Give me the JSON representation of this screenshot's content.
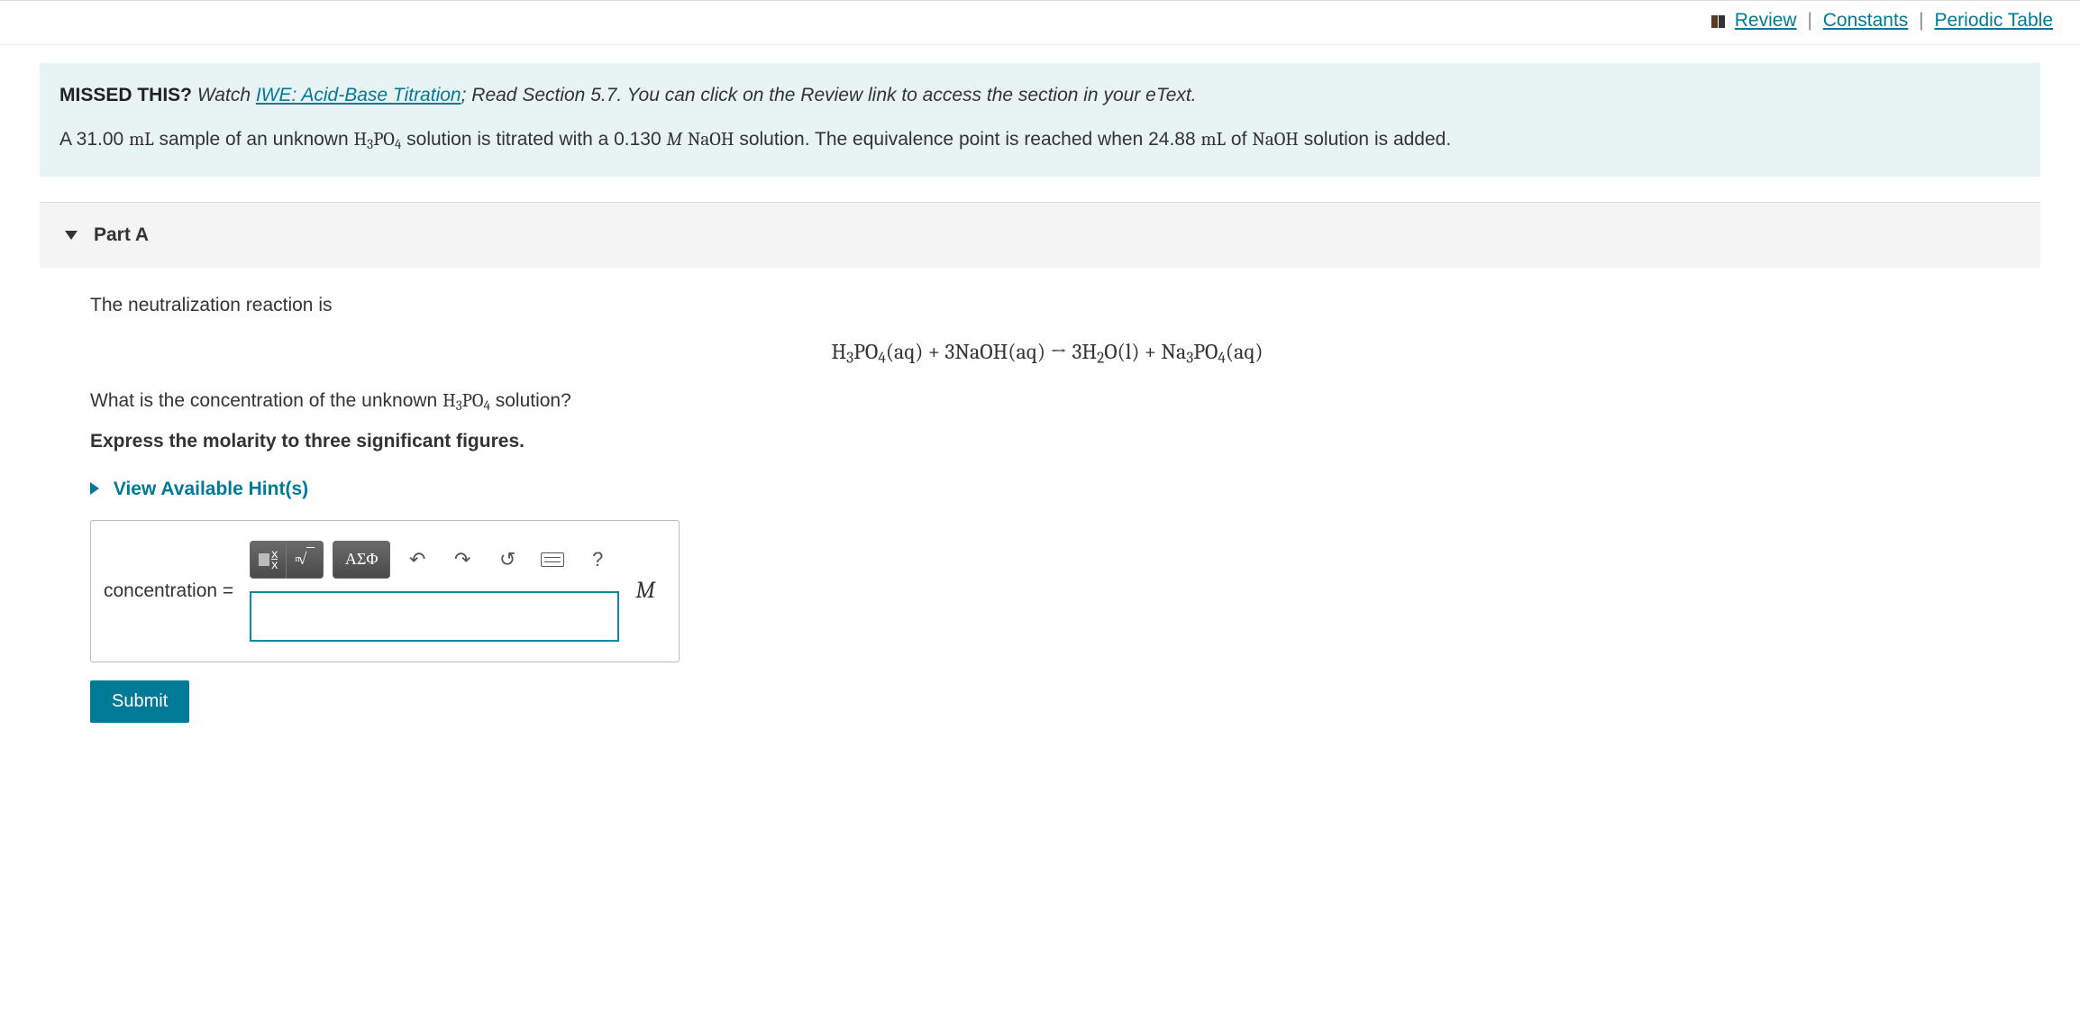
{
  "topnav": {
    "review": "Review",
    "constants": "Constants",
    "periodic": "Periodic Table"
  },
  "info": {
    "missed_label": "MISSED THIS?",
    "watch": "Watch ",
    "iwe_link": "IWE: Acid-Base Titration",
    "after_link": "; Read Section 5.7. You can click on the Review link to access the section in your eText.",
    "problem_pre": "A 31.00 ",
    "problem_ml1": "mL",
    "p2": " sample of an unknown ",
    "p3": " solution is titrated with a 0.130 ",
    "p_mnaoh_M": "M",
    "p4": " solution. The equivalence point is reached when 24.88 ",
    "problem_ml2": "mL",
    "p5": " of ",
    "p6": " solution is added."
  },
  "part": {
    "label": "Part A"
  },
  "q": {
    "intro": "The neutralization reaction is",
    "ask_pre": "What is the concentration of the unknown ",
    "ask_post": " solution?",
    "instruction": "Express the molarity to three significant figures.",
    "hints": "View Available Hint(s)"
  },
  "ans": {
    "label": "concentration =",
    "unit": "M",
    "symbols_btn": "ΑΣΦ",
    "help": "?"
  },
  "submit": "Submit"
}
